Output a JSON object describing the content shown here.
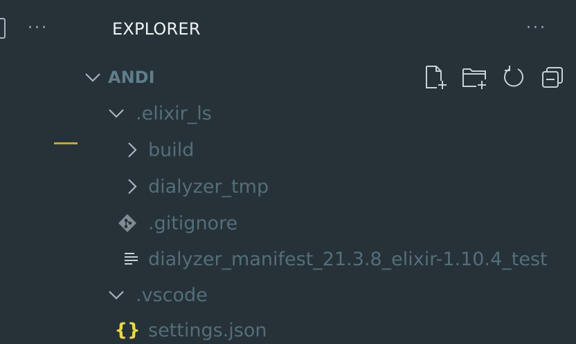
{
  "sidebar": {
    "title": "EXPLORER",
    "more_actions": "···"
  },
  "activity_bar": {
    "more_actions": "···"
  },
  "workspace": {
    "root_label": "ANDI",
    "actions": [
      "new-file-icon",
      "new-folder-icon",
      "refresh-icon",
      "collapse-all-icon"
    ]
  },
  "tree": {
    "items": [
      {
        "label": ".elixir_ls",
        "type": "folder",
        "expanded": true,
        "icon": "chevron-down-icon"
      },
      {
        "label": "build",
        "type": "folder",
        "expanded": false,
        "icon": "chevron-right-icon"
      },
      {
        "label": "dialyzer_tmp",
        "type": "folder",
        "expanded": false,
        "icon": "chevron-right-icon"
      },
      {
        "label": ".gitignore",
        "type": "file",
        "icon": "git-icon"
      },
      {
        "label": "dialyzer_manifest_21.3.8_elixir-1.10.4_test",
        "type": "file",
        "icon": "text-file-icon"
      },
      {
        "label": ".vscode",
        "type": "folder",
        "expanded": true,
        "icon": "chevron-down-icon"
      },
      {
        "label": "settings.json",
        "type": "file",
        "icon": "json-braces-icon",
        "glyph": "{}"
      }
    ]
  },
  "colors": {
    "background": "#263238",
    "title": "#eef2f4",
    "label": "#546e7a",
    "modified_marker": "#c4a63a",
    "json_icon": "#e6d94a"
  }
}
